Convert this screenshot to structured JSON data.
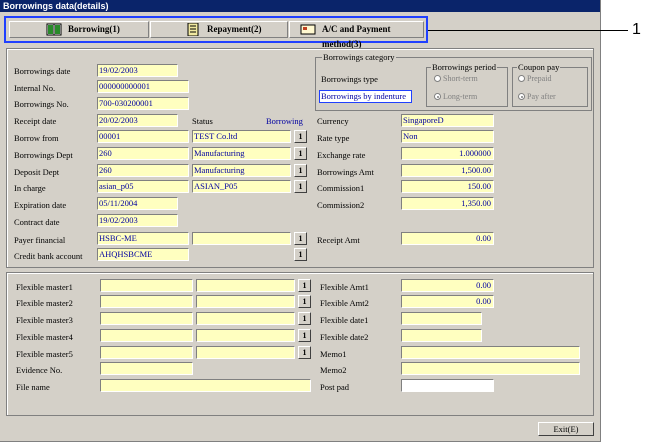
{
  "window": {
    "title": "Borrowings data(details)"
  },
  "tabs": [
    {
      "label": "Borrowing(1)",
      "icon": "book-icon"
    },
    {
      "label": "Repayment(2)",
      "icon": "ledger-icon"
    },
    {
      "label": "A/C and Payment method(3)",
      "icon": "card-icon"
    }
  ],
  "callout": "1",
  "left": {
    "borrowings_date": {
      "label": "Borrowings date",
      "value": "19/02/2003"
    },
    "internal_no": {
      "label": "Internal No.",
      "value": "000000000001"
    },
    "borrowings_no": {
      "label": "Borrowings No.",
      "value": "700-030200001"
    },
    "receipt_date": {
      "label": "Receipt date",
      "value": "20/02/2003"
    },
    "borrow_from": {
      "label": "Borrow from",
      "code": "00001",
      "name": "TEST Co.ltd"
    },
    "borrowings_dept": {
      "label": "Borrowings Dept",
      "code": "260",
      "name": "Manufacturing"
    },
    "deposit_dept": {
      "label": "Deposit Dept",
      "code": "260",
      "name": "Manufacturing"
    },
    "in_charge": {
      "label": "In charge",
      "code": "asian_p05",
      "name": "ASIAN_P05"
    },
    "expiration_date": {
      "label": "Expiration date",
      "value": "05/11/2004"
    },
    "contract_date": {
      "label": "Contract date",
      "value": "19/02/2003"
    },
    "payer_financial": {
      "label": "Payer financial",
      "code": "HSBC-ME",
      "name": ""
    },
    "credit_bank": {
      "label": "Credit bank account",
      "code": "AHQHSBCME"
    },
    "status": {
      "label": "Status",
      "value": "Borrowing"
    },
    "button_label": "1"
  },
  "category": {
    "title": "Borrowings category",
    "type_label": "Borrowings type",
    "type_value": "Borrowings by indenture",
    "period": {
      "title": "Borrowings period",
      "options": [
        "Short-term",
        "Long-term"
      ]
    },
    "coupon": {
      "title": "Coupon pay",
      "options": [
        "Prepaid",
        "Pay after"
      ]
    }
  },
  "right": {
    "currency": {
      "label": "Currency",
      "value": "SingaporeD"
    },
    "rate_type": {
      "label": "Rate type",
      "value": "Non"
    },
    "exchange_rate": {
      "label": "Exchange rate",
      "value": "1.000000"
    },
    "borrowings_amt": {
      "label": "Borrowings Amt",
      "value": "1,500.00"
    },
    "commission1": {
      "label": "Commission1",
      "value": "150.00"
    },
    "commission2": {
      "label": "Commission2",
      "value": "1,350.00"
    },
    "receipt_amt": {
      "label": "Receipt Amt",
      "value": "0.00"
    }
  },
  "flex": {
    "masters": [
      "Flexible master1",
      "Flexible master2",
      "Flexible master3",
      "Flexible master4",
      "Flexible master5"
    ],
    "evidence_label": "Evidence No.",
    "file_label": "File name",
    "amt1": {
      "label": "Flexible Amt1",
      "value": "0.00"
    },
    "amt2": {
      "label": "Flexible Amt2",
      "value": "0.00"
    },
    "date1": "Flexible date1",
    "date2": "Flexible date2",
    "memo1": "Memo1",
    "memo2": "Memo2",
    "post_pad": "Post pad"
  },
  "exit_label": "Exit(E)"
}
